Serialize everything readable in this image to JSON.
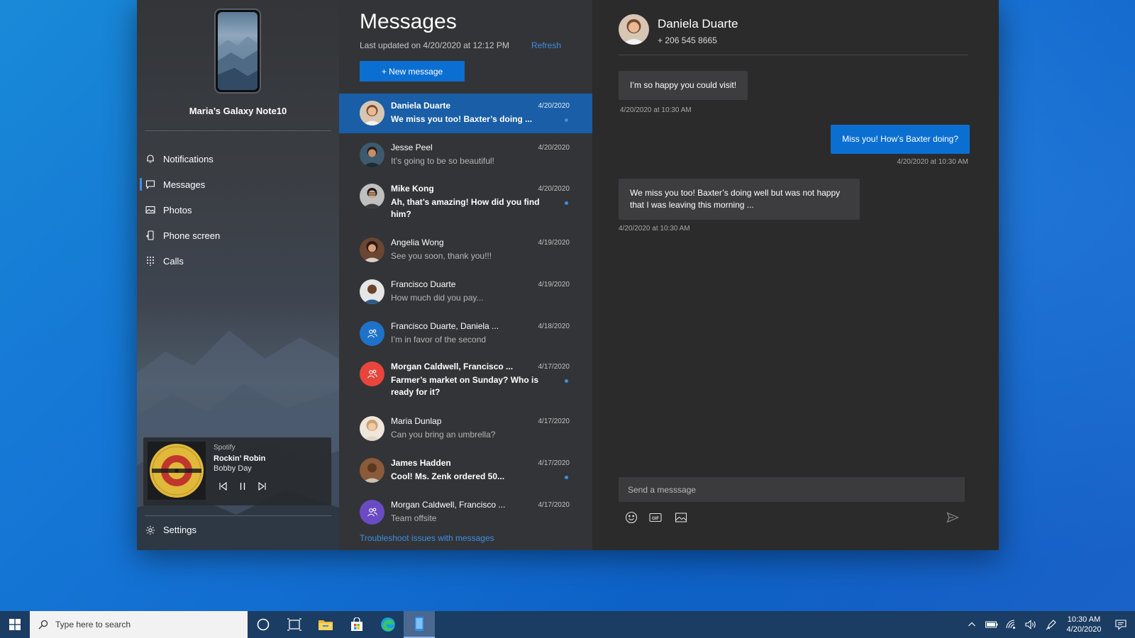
{
  "sidebar": {
    "device_name": "Maria’s Galaxy Note10",
    "nav": [
      {
        "label": "Notifications",
        "icon": "bell-icon"
      },
      {
        "label": "Messages",
        "icon": "chat-icon",
        "active": true
      },
      {
        "label": "Photos",
        "icon": "image-icon"
      },
      {
        "label": "Phone screen",
        "icon": "phone-screen-icon"
      },
      {
        "label": "Calls",
        "icon": "dialpad-icon"
      }
    ],
    "media": {
      "app": "Spotify",
      "track": "Rockin’ Robin",
      "artist": "Bobby Day"
    },
    "settings_label": "Settings"
  },
  "list": {
    "title": "Messages",
    "last_updated": "Last updated on 4/20/2020 at 12:12 PM",
    "refresh_label": "Refresh",
    "new_message_label": "+ New message",
    "conversations": [
      {
        "name": "Daniela Duarte",
        "date": "4/20/2020",
        "preview": "We miss you too! Baxter’s doing ...",
        "unread": true,
        "selected": true
      },
      {
        "name": "Jesse Peel",
        "date": "4/20/2020",
        "preview": "It’s going to be so beautiful!"
      },
      {
        "name": "Mike Kong",
        "date": "4/20/2020",
        "preview": "Ah, that’s amazing! How did you find him?",
        "unread": true
      },
      {
        "name": "Angelia Wong",
        "date": "4/19/2020",
        "preview": "See you soon, thank you!!!"
      },
      {
        "name": "Francisco Duarte",
        "date": "4/19/2020",
        "preview": "How much did you pay..."
      },
      {
        "name": "Francisco Duarte, Daniela ...",
        "date": "4/18/2020",
        "preview": "I’m in favor of the second",
        "group": true
      },
      {
        "name": "Morgan Caldwell, Francisco ...",
        "date": "4/17/2020",
        "preview": "Farmer’s market on Sunday? Who is ready for it?",
        "unread": true,
        "group": true
      },
      {
        "name": "Maria Dunlap",
        "date": "4/17/2020",
        "preview": "Can you bring an umbrella?"
      },
      {
        "name": "James Hadden",
        "date": "4/17/2020",
        "preview": "Cool! Ms. Zenk ordered 50...",
        "unread": true
      },
      {
        "name": "Morgan Caldwell, Francisco ...",
        "date": "4/17/2020",
        "preview": "Team offsite",
        "group": true
      }
    ],
    "troubleshoot_label": "Troubleshoot issues with messages"
  },
  "conversation": {
    "contact_name": "Daniela Duarte",
    "contact_phone": "+ 206 545 8665",
    "messages": [
      {
        "direction": "in",
        "text": "I’m so happy you could visit!",
        "time": "4/20/2020 at 10:30 AM"
      },
      {
        "direction": "out",
        "text": "Miss you! How’s Baxter doing?",
        "time": "4/20/2020 at 10:30 AM"
      },
      {
        "direction": "in",
        "text": "We miss you too! Baxter’s doing well but was not happy that I was leaving this morning ...",
        "time": "4/20/2020 at 10:30 AM"
      }
    ],
    "compose_placeholder": "Send a messsage",
    "gif_label": "GIF"
  },
  "taskbar": {
    "search_placeholder": "Type here to search",
    "time": "10:30 AM",
    "date": "4/20/2020"
  },
  "colors": {
    "accent": "#0b6fd2",
    "selected_row": "#195ea6",
    "link": "#3d8ee6",
    "avatar_group_1": "#1e73c9",
    "avatar_group_2": "#e8453c",
    "avatar_group_3": "#6a4bc4"
  }
}
